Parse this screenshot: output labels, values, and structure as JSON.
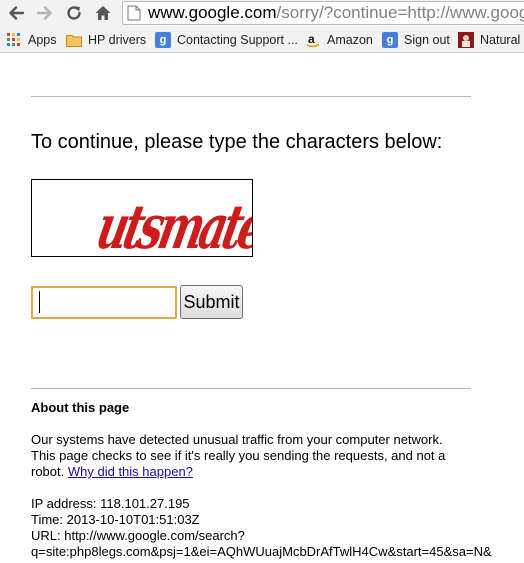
{
  "browser": {
    "url_host": "www.google.com",
    "url_rest": "/sorry/?continue=http://www.google",
    "bookmarks": [
      {
        "label": "Apps",
        "icon": "apps-grid-icon"
      },
      {
        "label": "HP drivers",
        "icon": "folder-icon"
      },
      {
        "label": "Contacting Support ...",
        "icon": "google-icon"
      },
      {
        "label": "Amazon",
        "icon": "amazon-icon"
      },
      {
        "label": "Sign out",
        "icon": "google-icon"
      },
      {
        "label": "Natural L",
        "icon": "bookmark-favicon-icon"
      }
    ]
  },
  "page": {
    "prompt": "To continue, please type the characters below:",
    "captcha_text": "utsmate",
    "captcha_color": "#cc1c1c",
    "input_value": "",
    "submit_label": "Submit",
    "about_heading": "About this page",
    "about_text": "Our systems have detected unusual traffic from your computer network. This page checks to see if it's really you sending the requests, and not a robot.",
    "why_link": "Why did this happen?",
    "ip_line": "IP address: 118.101.27.195",
    "time_line": "Time: 2013-10-10T01:51:03Z",
    "url_line": "URL: http://www.google.com/search?",
    "query_line": "q=site:php8legs.com&psj=1&ei=AQhWUuajMcbDrAfTwlH4Cw&start=45&sa=N&"
  },
  "colors": {
    "input_border": "#e0a84a",
    "link": "#1a0dab"
  }
}
